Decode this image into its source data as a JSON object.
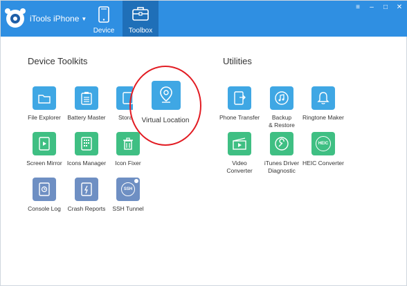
{
  "header": {
    "app_name": "iTools iPhone",
    "tabs": [
      {
        "label": "Device",
        "icon": "phone-icon"
      },
      {
        "label": "Toolbox",
        "icon": "toolbox-icon",
        "active": true
      }
    ],
    "window_controls": [
      "menu-icon",
      "minimize-icon",
      "maximize-icon",
      "close-icon"
    ]
  },
  "sections": {
    "device_toolkits": "Device Toolkits",
    "utilities": "Utilities"
  },
  "device_tools": {
    "file_explorer": "File Explorer",
    "battery_master": "Battery Master",
    "storage": "Stora",
    "screen_mirror": "Screen Mirror",
    "icons_manager": "Icons Manager",
    "icon_fixer": "Icon Fixer",
    "console_log": "Console Log",
    "crash_reports": "Crash Reports",
    "ssh_tunnel": "SSH Tunnel"
  },
  "highlight": {
    "label": "Virtual Location"
  },
  "utility_tools": {
    "phone_transfer": "Phone Transfer",
    "backup_restore_1": "Backup",
    "backup_restore_2": "& Restore",
    "ringtone_maker": "Ringtone Maker",
    "video_converter_1": "Video",
    "video_converter_2": "Converter",
    "itunes_driver_1": "iTunes Driver",
    "itunes_driver_2": "Diagnostic",
    "heic_converter": "HEIC Converter",
    "heic_icon_text": "HEIC",
    "ssh_icon_text": "SSH"
  },
  "colors": {
    "topbar": "#2f8fe2",
    "active_tab": "#1f6fb8",
    "blue_icon": "#3fa7e4",
    "green_icon": "#3fbf83",
    "slate_icon": "#6e8fc3",
    "highlight_circle": "#e21c23"
  }
}
